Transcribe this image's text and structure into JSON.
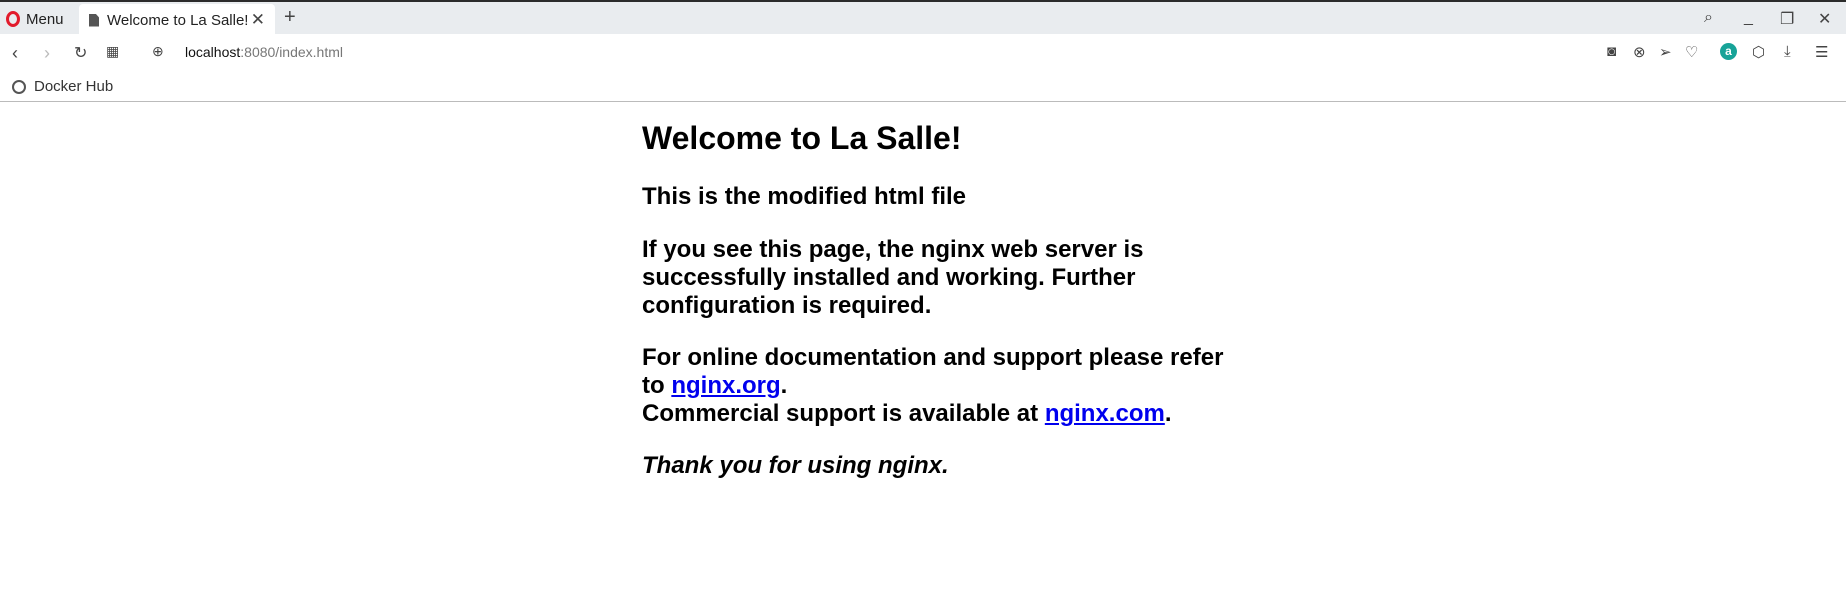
{
  "browser": {
    "menu_label": "Menu",
    "tab_title": "Welcome to La Salle!",
    "url_host": "localhost",
    "url_path": ":8080/index.html",
    "bookmarks": [
      {
        "label": "Docker Hub"
      }
    ],
    "extension_badge": "a"
  },
  "page": {
    "heading": "Welcome to La Salle!",
    "subheading": "This is the modified html file",
    "para1": "If you see this page, the nginx web server is successfully installed and working. Further configuration is required.",
    "para2_prefix": "For online documentation and support please refer to ",
    "link1": "nginx.org",
    "para2_mid": ".",
    "para2_line2": "Commercial support is available at ",
    "link2": "nginx.com",
    "para2_end": ".",
    "thanks": "Thank you for using nginx."
  },
  "colors": {
    "link": "#0000ee",
    "opera_red": "#e21b2c",
    "tabbar": "#e9ecef"
  }
}
